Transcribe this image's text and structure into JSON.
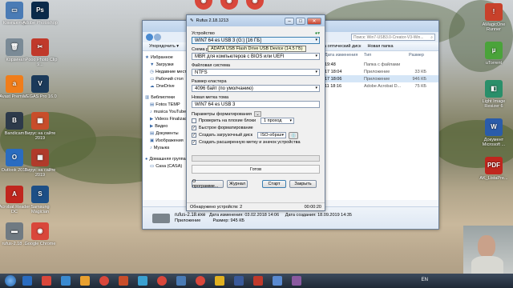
{
  "desktop_left": [
    {
      "label": "Компьютер",
      "color": "#4a7bb5",
      "glyph": "▭"
    },
    {
      "label": "Adobe Photoshop",
      "color": "#0a2a4a",
      "glyph": "Ps"
    },
    {
      "label": "Корзина",
      "color": "#7a8a96",
      "glyph": "🗑"
    },
    {
      "label": "nPooo Photo Clip 9...",
      "color": "#c0392b",
      "glyph": "✂"
    },
    {
      "label": "Avast Premiu...",
      "color": "#f07d1a",
      "glyph": "a"
    },
    {
      "label": "VEGAS Pro 16.0",
      "color": "#1b3a5a",
      "glyph": "V"
    },
    {
      "label": "Bandicam",
      "color": "#2d3a4a",
      "glyph": "B"
    },
    {
      "label": "Вирус на сайте 2019",
      "color": "#c84d2a",
      "glyph": "▦"
    },
    {
      "label": "Outlook 2013",
      "color": "#2a6cc0",
      "glyph": "O"
    },
    {
      "label": "Вирус на сайте 2019",
      "color": "#b03a2a",
      "glyph": "▦"
    },
    {
      "label": "Acrobat Reader DC",
      "color": "#c0261e",
      "glyph": "A"
    },
    {
      "label": "Samsung Magician",
      "color": "#1d4f86",
      "glyph": "S"
    },
    {
      "label": "rufus-2.18 ...",
      "color": "#707a82",
      "glyph": "▬"
    },
    {
      "label": "Google Chrome",
      "color": "#d9473b",
      "glyph": "◉"
    }
  ],
  "desktop_right": [
    {
      "label": "AMagicOne Runner",
      "color": "#c8412b",
      "glyph": "!"
    },
    {
      "label": "uTorrent",
      "color": "#4aa33a",
      "glyph": "µ"
    },
    {
      "label": "Light Image Resizer 6",
      "color": "#2a8f6a",
      "glyph": "◧"
    },
    {
      "label": "Документ Microsoft ...",
      "color": "#2a5caa",
      "glyph": "W"
    },
    {
      "label": "AK_ListaPre...",
      "color": "#c0261e",
      "glyph": "PDF"
    }
  ],
  "desktop_top": [
    {
      "label": "",
      "color": "#d9473b",
      "glyph": "◉"
    },
    {
      "label": "",
      "color": "#d9473b",
      "glyph": "◉"
    },
    {
      "label": "",
      "color": "#d9473b",
      "glyph": "◉"
    }
  ],
  "explorer": {
    "search_placeholder": "Поиск: Win7-USB3.0-Creator-V3-Win...",
    "toolbar": {
      "organize": "Упорядочить ▾",
      "burn": "ить на оптический диск",
      "newfolder": "Новая папка"
    },
    "nav": [
      {
        "label": "Избранное",
        "icon": "★"
      },
      {
        "label": "Загрузки",
        "icon": "▼"
      },
      {
        "label": "Недавние места",
        "icon": "◷"
      },
      {
        "label": "Рабочий стол",
        "icon": "▭"
      },
      {
        "label": "OneDrive",
        "icon": "☁"
      },
      {
        "label": "Библиотеки",
        "icon": "▥"
      },
      {
        "label": "Fotos TEMP",
        "icon": "▤"
      },
      {
        "label": "musica YouTube",
        "icon": "♪"
      },
      {
        "label": "Videos Finalizad",
        "icon": "▶"
      },
      {
        "label": "Видео",
        "icon": "▶"
      },
      {
        "label": "Документы",
        "icon": "▤"
      },
      {
        "label": "Изображения",
        "icon": "▣"
      },
      {
        "label": "Музыка",
        "icon": "♪"
      },
      {
        "label": "Домашняя группа",
        "icon": "●"
      },
      {
        "label": "Casa (CASA)",
        "icon": "▭"
      }
    ],
    "columns": [
      "Дата изменения",
      "Тип",
      "Размер"
    ],
    "rows": [
      {
        "date": "19:48",
        "type": "Папка с файлами",
        "size": ""
      },
      {
        "date": "17 18:04",
        "type": "Приложение",
        "size": "33 КБ"
      },
      {
        "date": "17 18:06",
        "type": "Приложение",
        "size": "946 КБ"
      },
      {
        "date": "11 18:16",
        "type": "Adobe Acrobat D...",
        "size": "75 КБ"
      }
    ],
    "footer": {
      "name": "rufus-2.18.exe",
      "date_label": "Дата изменения: 03.02.2018 14:06",
      "created": "Дата создания: 18.09.2019 14:35",
      "type": "Приложение",
      "size": "Размер: 945 КБ"
    }
  },
  "rufus": {
    "title": "Rufus 2.18.1213",
    "device_label": "Устройство",
    "device_value": "WIN7 64 es USB 3 (G:) [16 ГБ]",
    "tooltip": "ADATA USB Flash Drive USB Device (14.5 ГБ)",
    "scheme_label": "Схема р",
    "scheme_value": "MBR для компьютеров с BIOS или UEFI",
    "fs_label": "Файловая система",
    "fs_value": "NTFS",
    "cluster_label": "Размер кластера",
    "cluster_value": "4096 байт (по умолчанию)",
    "volume_label": "Новая метка тома",
    "volume_value": "WIN7 64 es USB 3",
    "format_params": "Параметры форматирования",
    "check_bad": "Проверить на плохие блоки",
    "passes": "1 проход",
    "quick_format": "Быстрое форматирование",
    "bootable": "Создать загрузочный диск",
    "iso": "ISO-образ",
    "ext_label": "Создать расширенную метку и значок устройства",
    "progress": 0,
    "status": "Готов",
    "about_btn": "О программе...",
    "log_btn": "Журнал",
    "start_btn": "Старт",
    "close_btn": "Закрыть",
    "found": "Обнаружено устройств: 2",
    "time": "00:00:20"
  },
  "taskbar": {
    "lang": "EN"
  },
  "taskbar_icons": [
    "#2a6cc0",
    "#d9473b",
    "#3a8ad0",
    "#e8a030",
    "#d9473b",
    "#c84d2a",
    "#3aa0d0",
    "#d9473b",
    "#4a7bb5",
    "#d9473b",
    "#e0b020",
    "#3a5a9a",
    "#c0392b",
    "#5a8ad0",
    "#8a5aa0"
  ]
}
